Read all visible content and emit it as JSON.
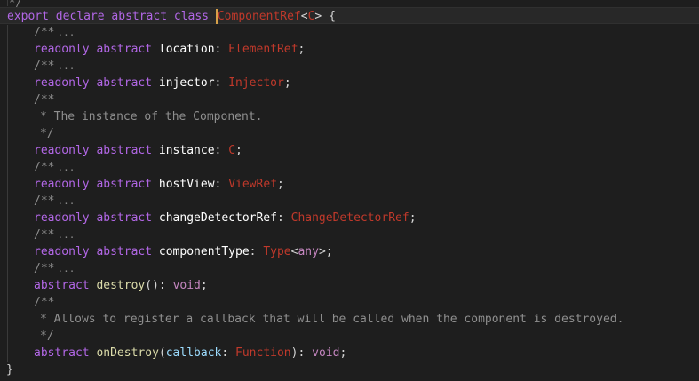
{
  "colors": {
    "background": "#1e1e1e",
    "keyword": "#c586c0",
    "type": "#c0392b",
    "comment": "#8f8f8f",
    "identifier": "#ffffff",
    "function": "#dcdcaa",
    "parameter": "#9cdcfe"
  },
  "top_fragment": "*/",
  "header": {
    "export": "export",
    "declare": "declare",
    "abstract": "abstract",
    "class": "class",
    "class_name": "ComponentRef",
    "generic_open": "<",
    "generic_param": "C",
    "generic_close": ">",
    "brace_open": "{"
  },
  "fold_marker": "/**",
  "fold_ellipsis": "...",
  "members": {
    "location": {
      "readonly": "readonly",
      "abstract": "abstract",
      "name": "location",
      "colon": ":",
      "type": "ElementRef",
      "semi": ";"
    },
    "injector": {
      "readonly": "readonly",
      "abstract": "abstract",
      "name": "injector",
      "colon": ":",
      "type": "Injector",
      "semi": ";"
    },
    "instance_doc": {
      "open": "/**",
      "body": "* The instance of the Component.",
      "close": "*/"
    },
    "instance": {
      "readonly": "readonly",
      "abstract": "abstract",
      "name": "instance",
      "colon": ":",
      "type": "C",
      "semi": ";"
    },
    "hostView": {
      "readonly": "readonly",
      "abstract": "abstract",
      "name": "hostView",
      "colon": ":",
      "type": "ViewRef",
      "semi": ";"
    },
    "changeDetectorRef": {
      "readonly": "readonly",
      "abstract": "abstract",
      "name": "changeDetectorRef",
      "colon": ":",
      "type": "ChangeDetectorRef",
      "semi": ";"
    },
    "componentType": {
      "readonly": "readonly",
      "abstract": "abstract",
      "name": "componentType",
      "colon": ":",
      "type": "Type",
      "generic_open": "<",
      "generic": "any",
      "generic_close": ">",
      "semi": ";"
    },
    "destroy": {
      "abstract": "abstract",
      "name": "destroy",
      "parens": "()",
      "colon": ":",
      "return": "void",
      "semi": ";"
    },
    "onDestroy_doc": {
      "open": "/**",
      "body": "* Allows to register a callback that will be called when the component is destroyed.",
      "close": "*/"
    },
    "onDestroy": {
      "abstract": "abstract",
      "name": "onDestroy",
      "paren_open": "(",
      "param": "callback",
      "colon": ":",
      "param_type": "Function",
      "paren_close": ")",
      "colon2": ":",
      "return": "void",
      "semi": ";"
    }
  },
  "closing_brace": "}"
}
